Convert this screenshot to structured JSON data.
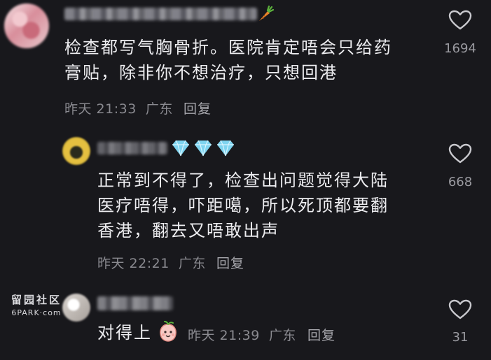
{
  "comments": [
    {
      "text_lines": [
        "检查都写气胸骨折。医院肯定唔会只给药",
        "膏贴，除非你不想治疗，只想回港"
      ],
      "time": "昨天 21:33",
      "location": "广东",
      "reply_label": "回复",
      "likes": "1694",
      "badge_icon": "carrot-icon"
    },
    {
      "text_lines": [
        "正常到不得了，检查出问题觉得大陆",
        "医疗唔得，吓距噶，所以死顶都要翻",
        "香港，翻去又唔敢出声"
      ],
      "time": "昨天 22:21",
      "location": "广东",
      "reply_label": "回复",
      "likes": "668",
      "badge_icon": "diamond-icon"
    },
    {
      "text": "对得上",
      "time": "昨天 21:39",
      "location": "广东",
      "reply_label": "回复",
      "likes": "31",
      "badge_icon": "peach-emoji-icon"
    }
  ],
  "watermark": {
    "title": "留园社区",
    "subtitle": "6PARK·com"
  },
  "colors": {
    "background": "#18181c",
    "text": "#ededf0",
    "meta": "#8a8a90",
    "diamond": "#7fd4f0",
    "carrot": "#e8822a"
  }
}
